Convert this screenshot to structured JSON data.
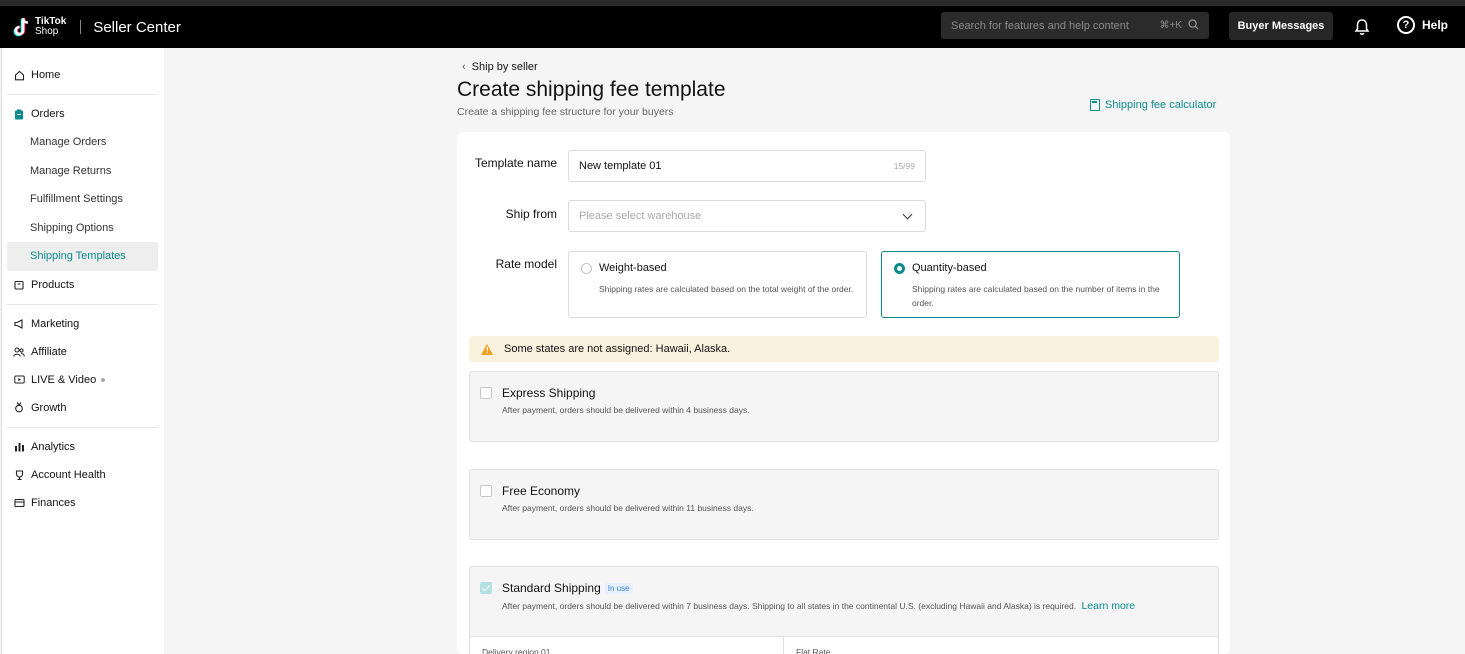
{
  "header": {
    "logo_line1": "TikTok",
    "logo_line2": "Shop",
    "app_title": "Seller Center",
    "search_placeholder": "Search for features and help content",
    "search_shortcut": "⌘+K",
    "buyer_messages_label": "Buyer Messages",
    "help_label": "Help"
  },
  "sidebar": {
    "home": "Home",
    "orders": "Orders",
    "order_items": [
      "Manage Orders",
      "Manage Returns",
      "Fulfillment Settings",
      "Shipping Options",
      "Shipping Templates"
    ],
    "products": "Products",
    "marketing": "Marketing",
    "affiliate": "Affiliate",
    "live_video": "LIVE & Video",
    "growth": "Growth",
    "analytics": "Analytics",
    "account_health": "Account Health",
    "finances": "Finances"
  },
  "page": {
    "back_label": "Ship by seller",
    "title": "Create shipping fee template",
    "subtitle": "Create a shipping fee structure for your buyers",
    "calculator_link": "Shipping fee calculator"
  },
  "form": {
    "template_name_label": "Template name",
    "template_name_value": "New template 01",
    "template_name_counter": "15/99",
    "ship_from_label": "Ship from",
    "ship_from_placeholder": "Please select warehouse",
    "rate_model_label": "Rate model",
    "rate_models": [
      {
        "title": "Weight-based",
        "desc": "Shipping rates are calculated based on the total weight of the order.",
        "selected": false
      },
      {
        "title": "Quantity-based",
        "desc": "Shipping rates are calculated based on the number of items in the order.",
        "selected": true
      }
    ]
  },
  "warning": {
    "text": "Some states are not assigned: Hawaii, Alaska."
  },
  "shipping_options": [
    {
      "name": "Express Shipping",
      "desc": "After payment, orders should be delivered within 4 business days.",
      "checked": false
    },
    {
      "name": "Free Economy",
      "desc": "After payment, orders should be delivered within 11 business days.",
      "checked": false
    },
    {
      "name": "Standard Shipping",
      "badge": "In use",
      "desc": "After payment, orders should be delivered within 7 business days. Shipping to all states in the continental U.S. (excluding Hawaii and Alaska) is required.",
      "learn_more": "Learn more",
      "checked": true
    }
  ],
  "table": {
    "col1": "Delivery region 01",
    "col2": "Flat Rate"
  },
  "colors": {
    "accent": "#0c8b8d",
    "warning_bg": "#fbf1df",
    "warning_icon": "#f0a020",
    "header_bg": "#000000"
  }
}
